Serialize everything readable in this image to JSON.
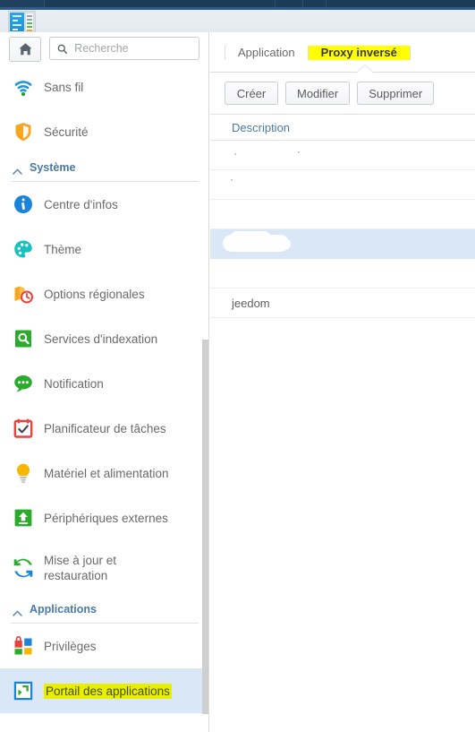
{
  "window": {
    "app_icon_name": "control-panel-icon"
  },
  "sidebar": {
    "home_button_icon": "home-icon",
    "search": {
      "icon": "search-icon",
      "placeholder": "Recherche",
      "value": ""
    },
    "items": [
      {
        "label": "Sans fil",
        "icon": "wifi-icon",
        "type": "item",
        "selected": false
      },
      {
        "label": "Sécurité",
        "icon": "shield-icon",
        "type": "item",
        "selected": false
      },
      {
        "label": "Système",
        "icon": "chevron-up-icon",
        "type": "group"
      },
      {
        "label": "Centre d'infos",
        "icon": "info-circle-icon",
        "type": "item",
        "selected": false
      },
      {
        "label": "Thème",
        "icon": "palette-icon",
        "type": "item",
        "selected": false
      },
      {
        "label": "Options régionales",
        "icon": "regional-clock-icon",
        "type": "item",
        "selected": false
      },
      {
        "label": "Services d'indexation",
        "icon": "indexing-search-icon",
        "type": "item",
        "selected": false
      },
      {
        "label": "Notification",
        "icon": "chat-bubble-icon",
        "type": "item",
        "selected": false
      },
      {
        "label": "Planificateur de tâches",
        "icon": "calendar-check-icon",
        "type": "item",
        "selected": false
      },
      {
        "label": "Matériel et alimentation",
        "icon": "lightbulb-icon",
        "type": "item",
        "selected": false
      },
      {
        "label": "Périphériques externes",
        "icon": "external-device-icon",
        "type": "item",
        "selected": false
      },
      {
        "label": "Mise à jour et restauration",
        "icon": "refresh-arrows-icon",
        "type": "item",
        "selected": false
      },
      {
        "label": "Applications",
        "icon": "chevron-up-icon",
        "type": "group"
      },
      {
        "label": "Privilèges",
        "icon": "privileges-squares-icon",
        "type": "item",
        "selected": false
      },
      {
        "label": "Portail des applications",
        "icon": "app-portal-icon",
        "type": "item",
        "selected": true,
        "highlighted": true
      }
    ],
    "scrollbar_name": "sidebar-scrollbar"
  },
  "content": {
    "tabs": [
      {
        "label": "Application",
        "active": false
      },
      {
        "label": "Proxy inversé",
        "active": true,
        "highlighted": true
      }
    ],
    "actions": [
      {
        "label": "Créer"
      },
      {
        "label": "Modifier"
      },
      {
        "label": "Supprimer"
      }
    ],
    "table": {
      "columns": [
        "Description"
      ],
      "rows": [
        {
          "description": "",
          "selected": false,
          "redacted": false
        },
        {
          "description": "",
          "selected": false,
          "redacted": false
        },
        {
          "description": "",
          "selected": false,
          "redacted": false
        },
        {
          "description": "",
          "selected": true,
          "redacted": true
        },
        {
          "description": "",
          "selected": false,
          "redacted": false
        },
        {
          "description": "jeedom",
          "selected": false,
          "redacted": false
        }
      ]
    }
  },
  "colors": {
    "accent_blue": "#4a7aa8",
    "selection_blue": "#d9e7f7",
    "highlight_yellow": "#ffff00",
    "sidebar_highlight": "#e8f000",
    "topbar_navy": "#1d3a57"
  }
}
